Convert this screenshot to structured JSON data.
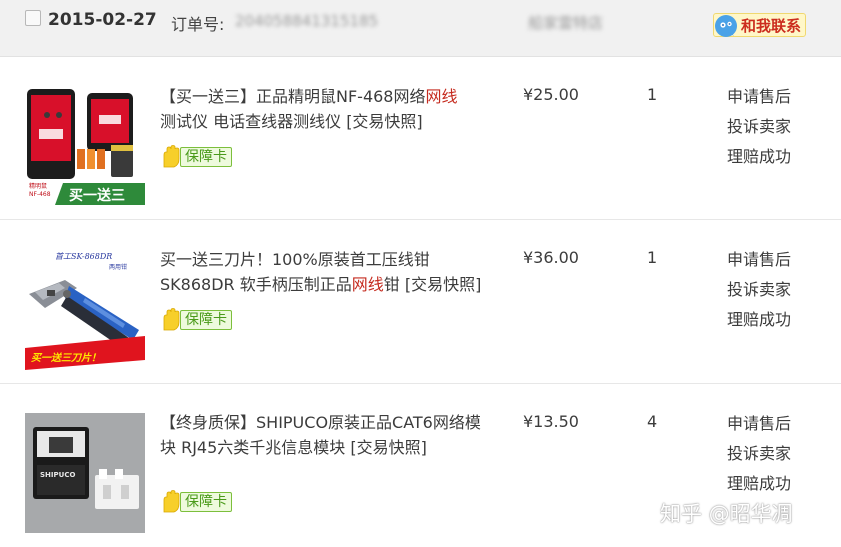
{
  "order": {
    "date": "2015-02-27",
    "order_no_label": "订单号:",
    "order_no_value": "204058841315185",
    "seller_name": "船家雷特店",
    "contact_label": "和我联系"
  },
  "items": [
    {
      "title_before": "【买一送三】正品精明鼠NF-468网络",
      "title_highlight": "网线",
      "title_after": "测试仪 电话查线器测线仪",
      "snapshot_label": "[交易快照]",
      "guarantee_label": "保障卡",
      "price": "¥25.00",
      "quantity": "1",
      "actions": [
        "申请售后",
        "投诉卖家",
        "理赔成功"
      ],
      "thumb_brand": "精明鼠",
      "thumb_model": "NF-468",
      "thumb_banner": "买一送三"
    },
    {
      "title_before": "买一送三刀片！100%原装首工压线钳SK868DR 软手柄压制正品",
      "title_highlight": "网线",
      "title_after": "钳",
      "snapshot_label": "[交易快照]",
      "guarantee_label": "保障卡",
      "price": "¥36.00",
      "quantity": "1",
      "actions": [
        "申请售后",
        "投诉卖家",
        "理赔成功"
      ],
      "thumb_brand": "首工SK-868DR",
      "thumb_model": "两用钳",
      "thumb_banner": "买一送三刀片！"
    },
    {
      "title_before": "【终身质保】SHIPUCO原装正品CAT6网络模块 RJ45六类千兆信息模块",
      "title_highlight": "",
      "title_after": "",
      "snapshot_label": "[交易快照]",
      "guarantee_label": "保障卡",
      "price": "¥13.50",
      "quantity": "4",
      "actions": [
        "申请售后",
        "投诉卖家",
        "理赔成功"
      ],
      "thumb_brand": "SHIPUCO",
      "thumb_model": "",
      "thumb_banner": ""
    }
  ],
  "watermark": "知乎 @昭华凋",
  "icons": {
    "contact": "chat-bubble-icon",
    "guarantee": "hand-shield-icon"
  },
  "colors": {
    "highlight": "#c52b1f",
    "badge_green": "#4a9a1a",
    "contact_red": "#cc2d1e"
  }
}
